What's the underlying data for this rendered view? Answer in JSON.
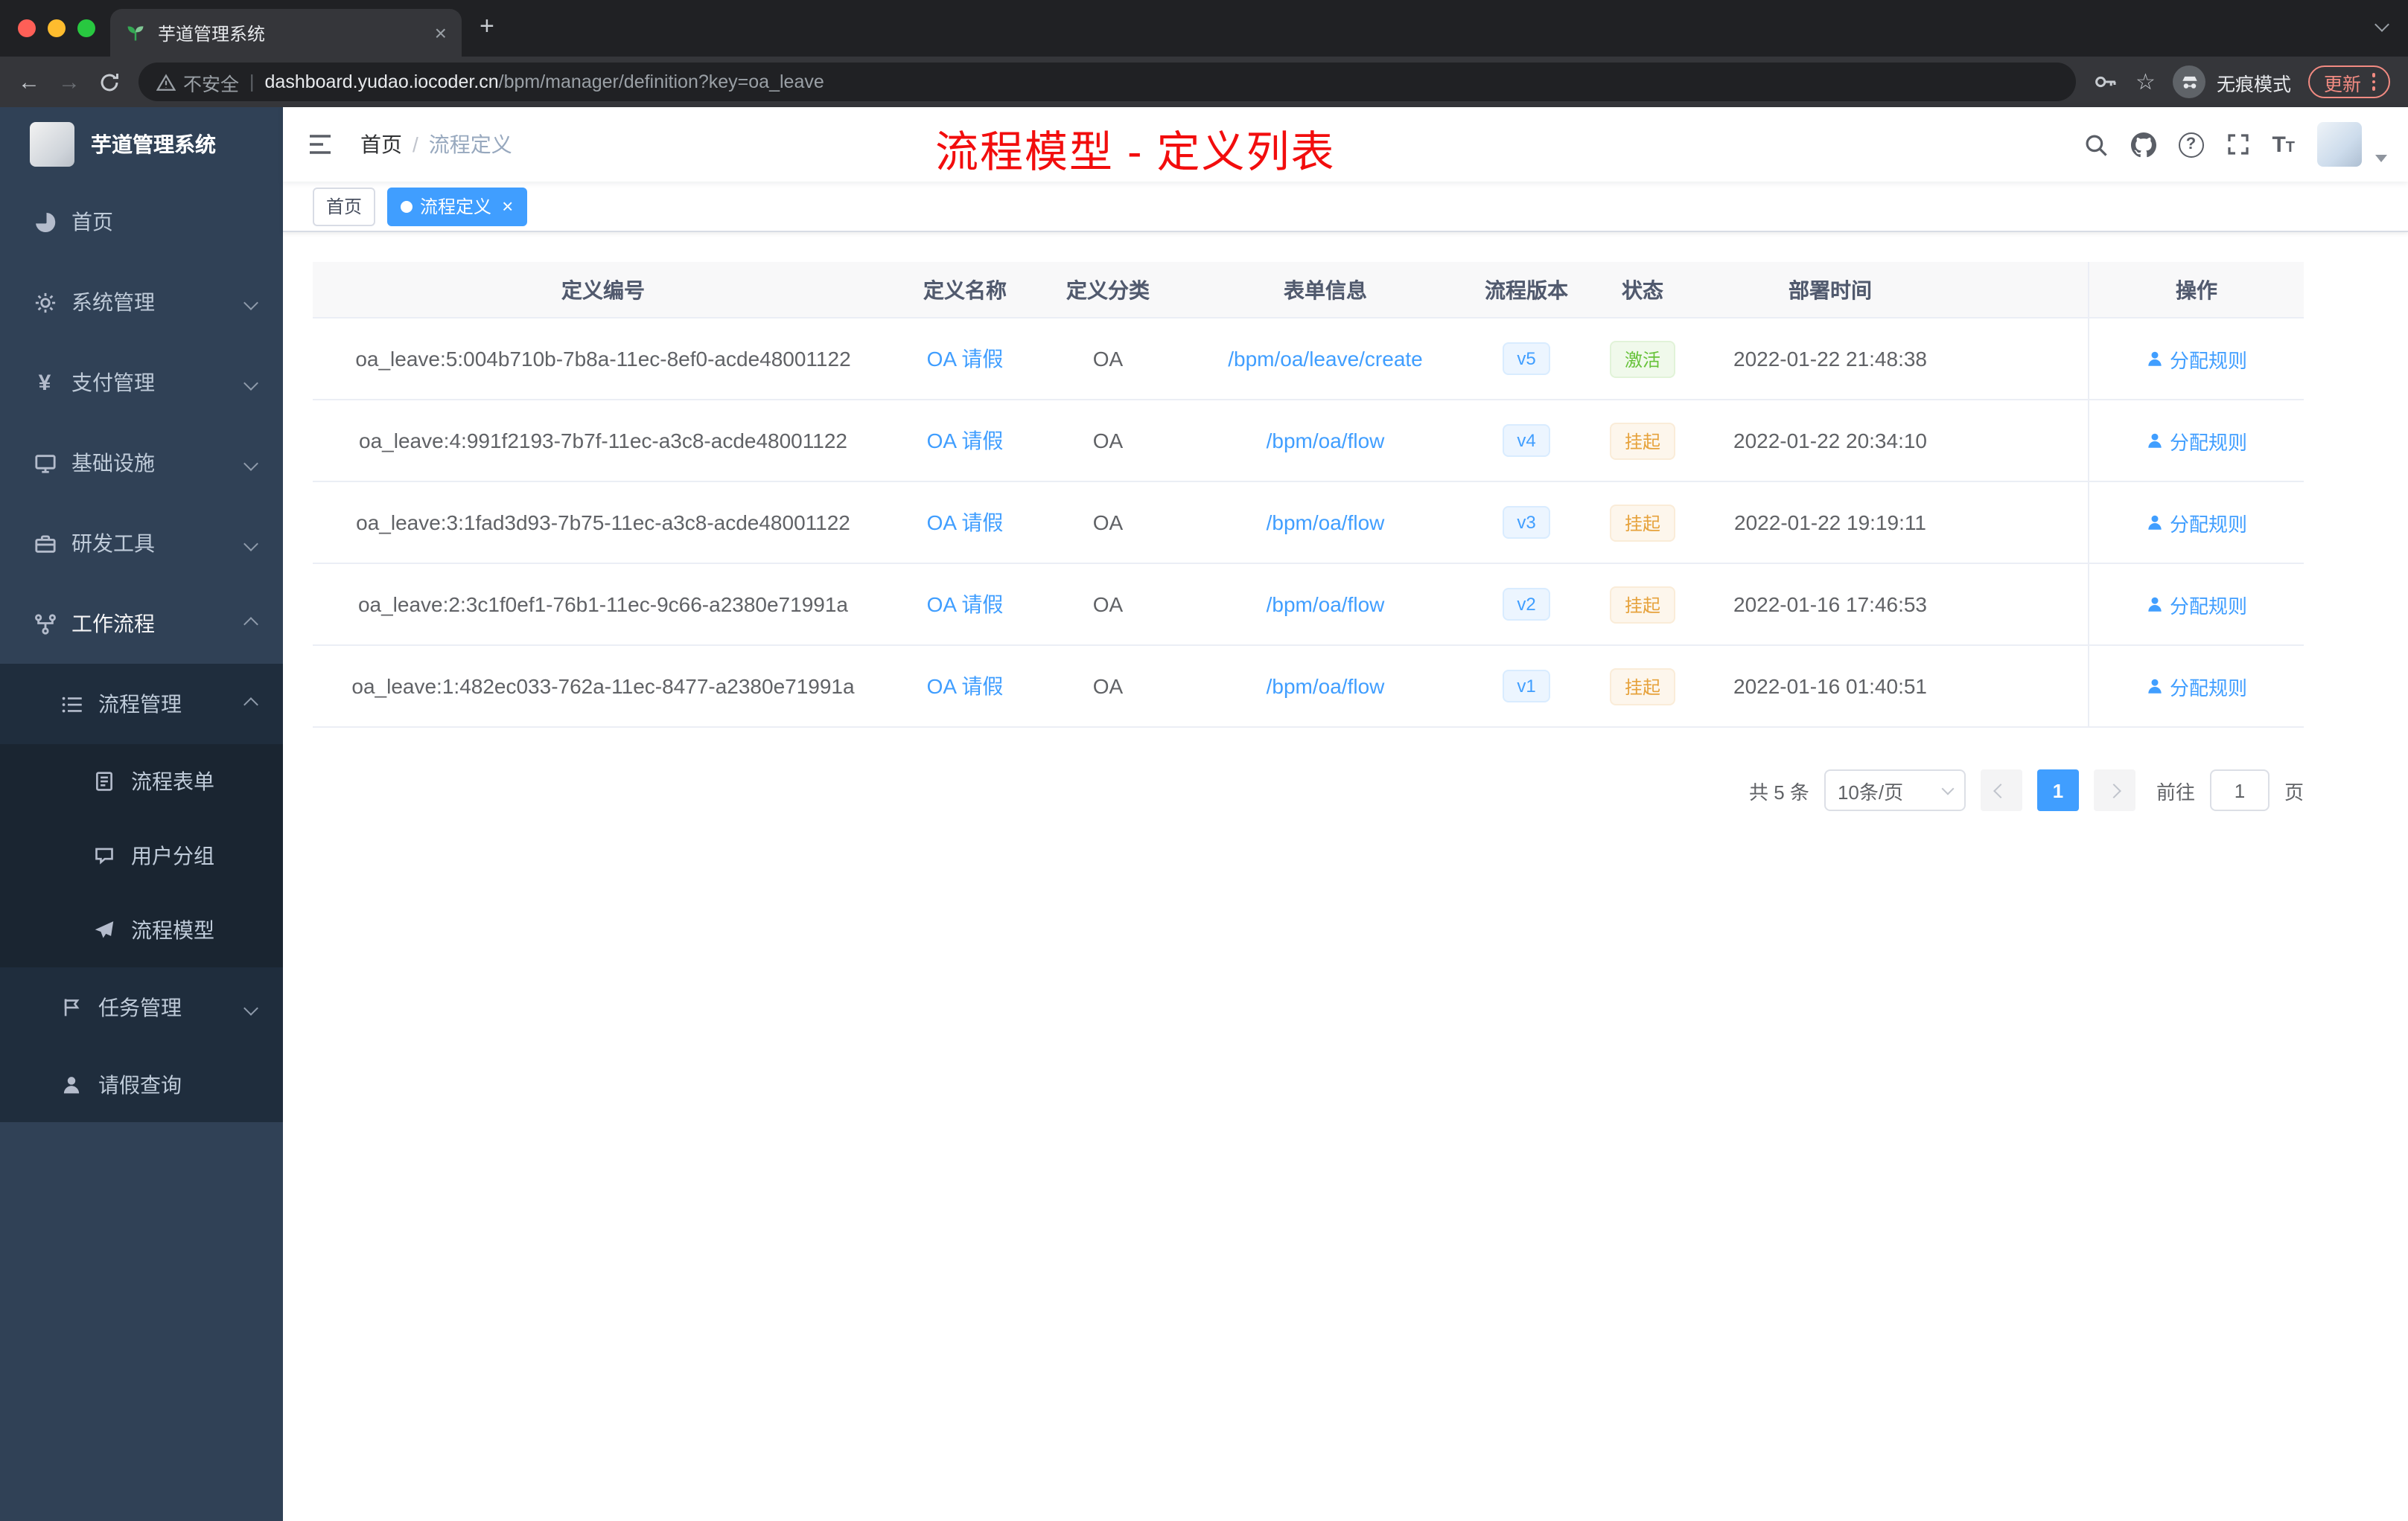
{
  "icons": {
    "close": "×",
    "plus": "+",
    "star": "☆",
    "back": "←",
    "forward": "→",
    "question": "?",
    "sep": "|",
    "slash": "/",
    "yen": "¥"
  },
  "browser": {
    "tab_title": "芋道管理系统",
    "security_label": "不安全",
    "url_domain": "dashboard.yudao.iocoder.cn",
    "url_path": "/bpm/manager/definition?key=oa_leave",
    "incognito_label": "无痕模式",
    "update_label": "更新"
  },
  "sidebar": {
    "logo_title": "芋道管理系统",
    "items": [
      {
        "label": "首页"
      },
      {
        "label": "系统管理"
      },
      {
        "label": "支付管理"
      },
      {
        "label": "基础设施"
      },
      {
        "label": "研发工具"
      },
      {
        "label": "工作流程"
      },
      {
        "label": "流程管理"
      },
      {
        "label": "流程表单"
      },
      {
        "label": "用户分组"
      },
      {
        "label": "流程模型"
      },
      {
        "label": "任务管理"
      },
      {
        "label": "请假查询"
      }
    ]
  },
  "header": {
    "breadcrumb_home": "首页",
    "breadcrumb_current": "流程定义",
    "annotation": "流程模型 - 定义列表"
  },
  "tags": {
    "home": "首页",
    "active": "流程定义"
  },
  "table": {
    "columns": [
      "定义编号",
      "定义名称",
      "定义分类",
      "表单信息",
      "流程版本",
      "状态",
      "部署时间",
      "操作"
    ],
    "rows": [
      {
        "id": "oa_leave:5:004b710b-7b8a-11ec-8ef0-acde48001122",
        "name": "OA 请假",
        "category": "OA",
        "form": "/bpm/oa/leave/create",
        "version": "v5",
        "status": "激活",
        "status_type": "success",
        "time": "2022-01-22 21:48:38",
        "action": "分配规则"
      },
      {
        "id": "oa_leave:4:991f2193-7b7f-11ec-a3c8-acde48001122",
        "name": "OA 请假",
        "category": "OA",
        "form": "/bpm/oa/flow",
        "version": "v4",
        "status": "挂起",
        "status_type": "warning",
        "time": "2022-01-22 20:34:10",
        "action": "分配规则"
      },
      {
        "id": "oa_leave:3:1fad3d93-7b75-11ec-a3c8-acde48001122",
        "name": "OA 请假",
        "category": "OA",
        "form": "/bpm/oa/flow",
        "version": "v3",
        "status": "挂起",
        "status_type": "warning",
        "time": "2022-01-22 19:19:11",
        "action": "分配规则"
      },
      {
        "id": "oa_leave:2:3c1f0ef1-76b1-11ec-9c66-a2380e71991a",
        "name": "OA 请假",
        "category": "OA",
        "form": "/bpm/oa/flow",
        "version": "v2",
        "status": "挂起",
        "status_type": "warning",
        "time": "2022-01-16 17:46:53",
        "action": "分配规则"
      },
      {
        "id": "oa_leave:1:482ec033-762a-11ec-8477-a2380e71991a",
        "name": "OA 请假",
        "category": "OA",
        "form": "/bpm/oa/flow",
        "version": "v1",
        "status": "挂起",
        "status_type": "warning",
        "time": "2022-01-16 01:40:51",
        "action": "分配规则"
      }
    ]
  },
  "pagination": {
    "total": "共 5 条",
    "page_size": "10条/页",
    "current_page": "1",
    "goto_label": "前往",
    "goto_value": "1",
    "unit_label": "页"
  },
  "colors": {
    "accent": "#409eff",
    "success": "#67c23a",
    "warning": "#e6a23c",
    "annotation_red": "#f20d0d",
    "sidebar_bg": "#304156"
  }
}
